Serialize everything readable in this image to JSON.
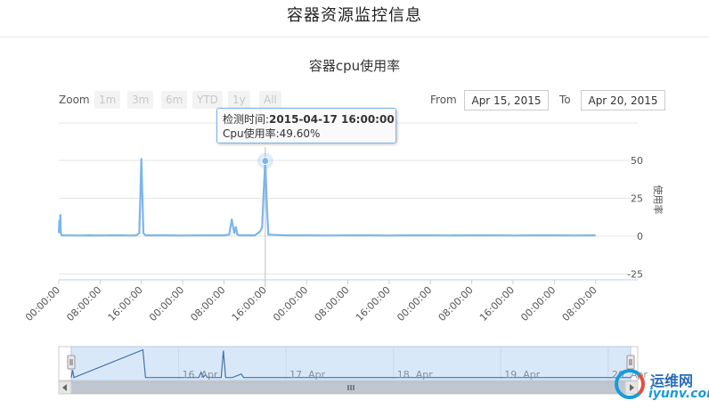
{
  "page": {
    "title": "容器资源监控信息"
  },
  "zoom": {
    "label": "Zoom",
    "buttons": [
      "1m",
      "3m",
      "6m",
      "YTD",
      "1y",
      "All"
    ]
  },
  "range": {
    "from_label": "From",
    "from_value": "Apr 15, 2015",
    "to_label": "To",
    "to_value": "Apr 20, 2015"
  },
  "tooltip": {
    "time_label": "检测时间:",
    "time_value": "2015-04-17 16:00:00",
    "cpu_label": "Cpu使用率:",
    "cpu_value": "49.60%"
  },
  "colors": {
    "series": "#7cb5ec",
    "navigator_fill": "#d9e8f8",
    "grid": "#e6e6e6"
  },
  "chart_data": {
    "type": "line",
    "title": "容器cpu使用率",
    "ylabel": "使用率",
    "ylim": [
      -25,
      50
    ],
    "y_ticks": [
      "50",
      "25",
      "0",
      "-25"
    ],
    "x_ticks": [
      "00:00:00",
      "08:00:00",
      "16:00:00",
      "00:00:00",
      "08:00:00",
      "16:00:00",
      "00:00:00",
      "08:00:00",
      "16:00:00",
      "00:00:00",
      "08:00:00",
      "16:00:00",
      "00:00:00",
      "08:00:00"
    ],
    "x_range": [
      "2015-04-15 00:00:00",
      "2015-04-19 08:00:00"
    ],
    "series": [
      {
        "points": [
          [
            0.0,
            2
          ],
          [
            0.1,
            10
          ],
          [
            0.2,
            5
          ],
          [
            0.3,
            14
          ],
          [
            0.4,
            2
          ],
          [
            0.6,
            0.5
          ],
          [
            4.0,
            0.4
          ],
          [
            6.0,
            0.5
          ],
          [
            8.0,
            0.4
          ],
          [
            10.0,
            0.5
          ],
          [
            12.0,
            0.5
          ],
          [
            14.0,
            0.4
          ],
          [
            15.0,
            0.5
          ],
          [
            15.6,
            2
          ],
          [
            16.0,
            51
          ],
          [
            16.4,
            2
          ],
          [
            16.8,
            0.5
          ],
          [
            20.0,
            0.5
          ],
          [
            24.0,
            0.4
          ],
          [
            28.0,
            0.5
          ],
          [
            32.0,
            0.5
          ],
          [
            33.0,
            1
          ],
          [
            33.5,
            11
          ],
          [
            34.0,
            2
          ],
          [
            34.3,
            6
          ],
          [
            34.6,
            1
          ],
          [
            35.0,
            0.5
          ],
          [
            38.0,
            0.5
          ],
          [
            39.0,
            3
          ],
          [
            39.4,
            6
          ],
          [
            39.7,
            30
          ],
          [
            40.0,
            49.6
          ],
          [
            40.3,
            20
          ],
          [
            40.6,
            1
          ],
          [
            44.0,
            0.5
          ],
          [
            48.0,
            0.5
          ],
          [
            52.0,
            0.4
          ],
          [
            56.0,
            0.5
          ],
          [
            60.0,
            0.5
          ],
          [
            64.0,
            0.4
          ],
          [
            68.0,
            0.5
          ],
          [
            72.0,
            0.5
          ],
          [
            76.0,
            0.4
          ],
          [
            80.0,
            0.5
          ],
          [
            84.0,
            0.5
          ],
          [
            88.0,
            0.4
          ],
          [
            92.0,
            0.5
          ],
          [
            96.0,
            0.5
          ],
          [
            100.0,
            0.4
          ],
          [
            104.0,
            0.5
          ]
        ]
      }
    ],
    "navigator_labels": [
      "16. Apr",
      "17. Apr",
      "18. Apr",
      "19. Apr",
      "20. Apr"
    ],
    "navigator_hours": [
      24,
      48,
      72,
      96,
      120
    ],
    "navigator_points": [
      [
        0,
        0.5
      ],
      [
        0.3,
        14
      ],
      [
        0.6,
        0.5
      ],
      [
        16,
        51
      ],
      [
        16.6,
        0.5
      ],
      [
        24,
        0.5
      ],
      [
        28.5,
        0.5
      ],
      [
        29,
        10
      ],
      [
        29.5,
        1
      ],
      [
        30,
        6
      ],
      [
        30.5,
        0.5
      ],
      [
        33.5,
        0.5
      ],
      [
        34,
        49.6
      ],
      [
        34.5,
        0.5
      ],
      [
        36,
        0.5
      ],
      [
        38,
        7
      ],
      [
        38.5,
        0.5
      ],
      [
        50,
        0.5
      ],
      [
        70,
        0.5
      ],
      [
        90,
        0.5
      ],
      [
        110,
        0.5
      ],
      [
        125,
        0.5
      ]
    ]
  },
  "watermark": {
    "line1": "运维网",
    "line2": "iyunv.com"
  }
}
